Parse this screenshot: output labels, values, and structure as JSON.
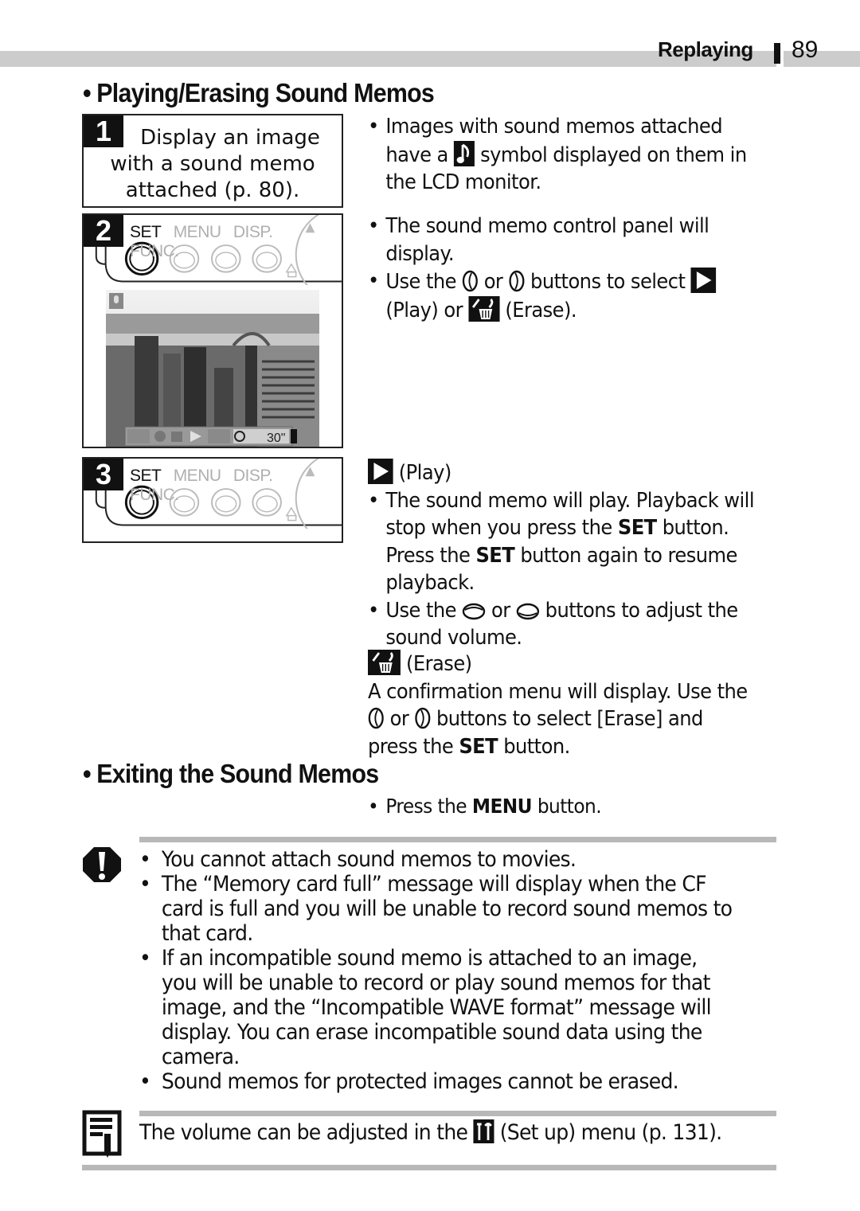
{
  "header": {
    "section": "Replaying",
    "page_number": "89"
  },
  "section1": {
    "title": "Playing/Erasing Sound Memos",
    "steps": [
      {
        "number": "1",
        "text_lines": [
          "Display an image",
          "with a sound memo",
          "attached (p. 80)."
        ]
      },
      {
        "number": "2",
        "camera_labels": [
          "SET",
          "MENU",
          "DISP.",
          "FUNC."
        ],
        "lcd_timer": "30\""
      },
      {
        "number": "3",
        "camera_labels": [
          "SET",
          "MENU",
          "DISP.",
          "FUNC."
        ]
      }
    ],
    "col1": {
      "line1": "Images with sound memos attached",
      "line2a": "have a",
      "line2b": "symbol displayed on them in",
      "line3": "the LCD monitor."
    },
    "col2": {
      "line1": "The sound memo control panel will",
      "line2": "display.",
      "line3a": "Use the",
      "line3b": "or",
      "line3c": "buttons to select",
      "line4a": "(Play) or",
      "line4b": "(Erase)."
    },
    "play": {
      "heading": "(Play)",
      "l1": "The sound memo will play. Playback will",
      "l2a": "stop when you press the",
      "l2b": "SET",
      "l2c": "button.",
      "l3a": "Press the",
      "l3b": "SET",
      "l3c": "button again to resume",
      "l4": "playback.",
      "l5a": "Use the",
      "l5b": "or",
      "l5c": "buttons to adjust the",
      "l6": "sound volume."
    },
    "erase": {
      "heading": "(Erase)",
      "l1": "A confirmation menu will display. Use the",
      "l2a": "or",
      "l2b": "buttons to select [Erase] and",
      "l3a": "press the",
      "l3b": "SET",
      "l3c": "button."
    }
  },
  "section2": {
    "title": "Exiting the Sound Memos",
    "l1a": "Press the",
    "l1b": "MENU",
    "l1c": "button."
  },
  "caution": {
    "icon": "caution-icon",
    "items": [
      [
        "You cannot attach sound memos to movies."
      ],
      [
        "The “Memory card full” message will display when the CF",
        "card is full and you will be unable to record sound memos to",
        "that card."
      ],
      [
        "If an incompatible sound memo is attached to an image,",
        "you will be unable to record or play sound memos for that",
        "image, and the “Incompatible WAVE format” message will",
        "display. You can erase incompatible sound data using the",
        "camera."
      ],
      [
        "Sound memos for protected images cannot be erased."
      ]
    ]
  },
  "note": {
    "icon": "memo-icon",
    "text_a": "The volume can be adjusted in the",
    "text_b": "(Set up) menu (p. 131)."
  }
}
